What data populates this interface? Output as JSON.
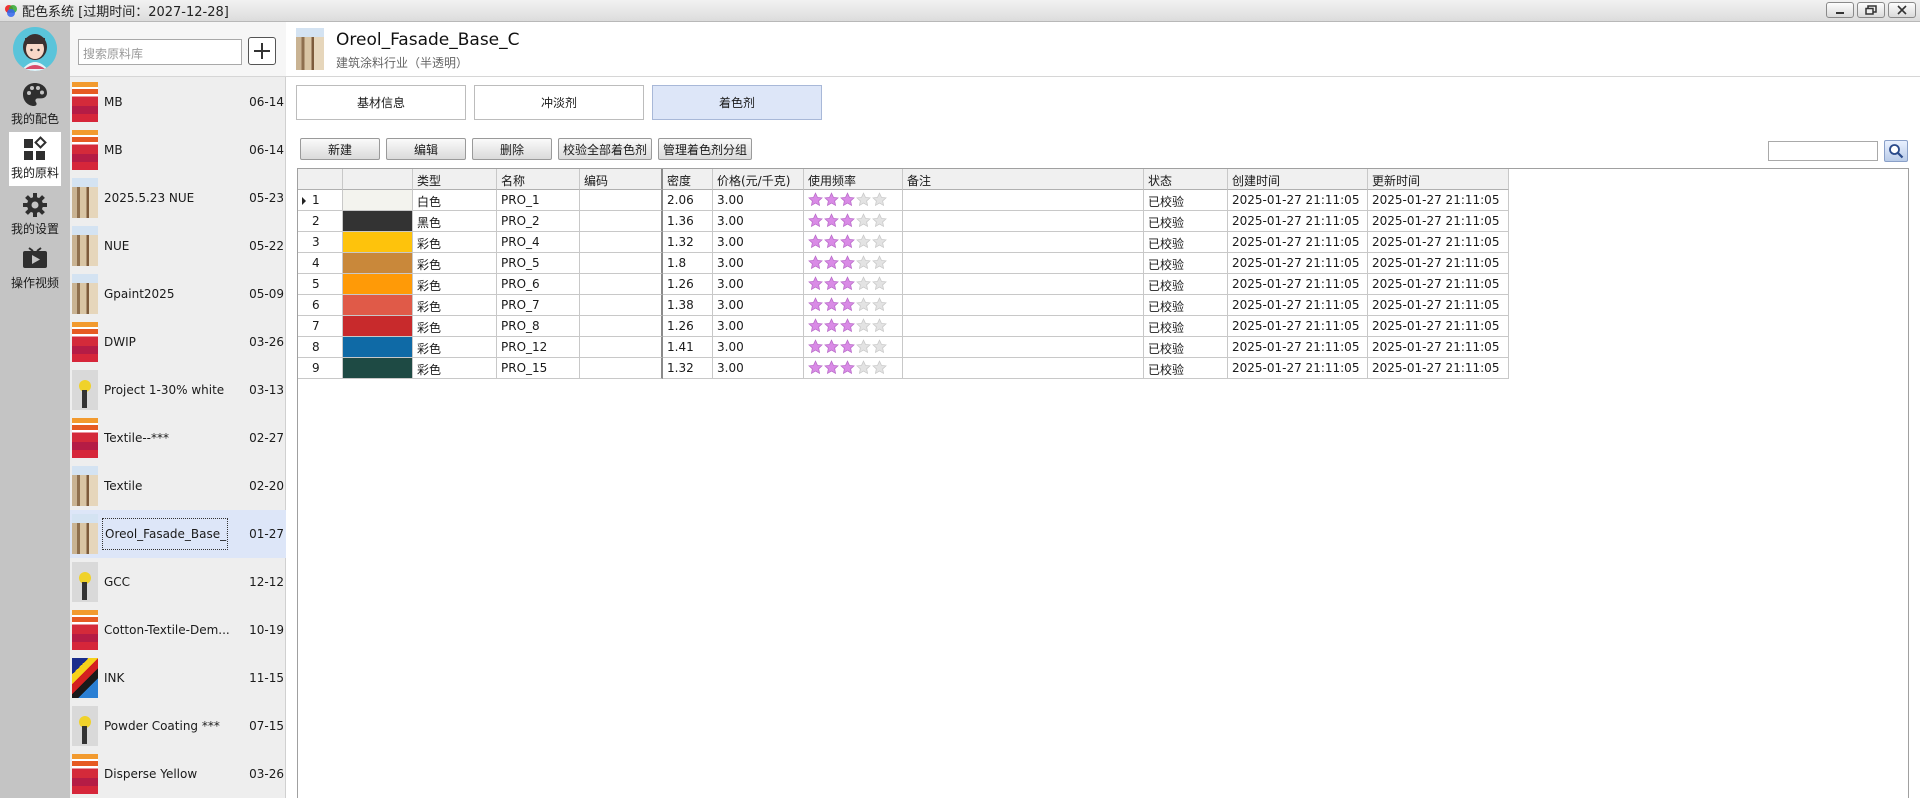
{
  "window": {
    "title": "配色系统  [过期时间：2027-12-28]",
    "buttons": [
      "minimize",
      "restore",
      "close"
    ]
  },
  "nav": {
    "items": [
      {
        "label": "我的配色",
        "icon": "palette-icon",
        "active": false
      },
      {
        "label": "我的原料",
        "icon": "grid-icon",
        "active": true
      },
      {
        "label": "我的设置",
        "icon": "gear-icon",
        "active": false
      },
      {
        "label": "操作视频",
        "icon": "video-icon",
        "active": false
      }
    ]
  },
  "library": {
    "search_placeholder": "搜索原料库",
    "add_label": "+",
    "items": [
      {
        "name": "MB",
        "date": "06-14",
        "thumb": "stripes"
      },
      {
        "name": "MB",
        "date": "06-14",
        "thumb": "stripes"
      },
      {
        "name": "2025.5.23 NUE",
        "date": "05-23",
        "thumb": "building"
      },
      {
        "name": "NUE",
        "date": "05-22",
        "thumb": "building"
      },
      {
        "name": "Gpaint2025",
        "date": "05-09",
        "thumb": "building"
      },
      {
        "name": "DWIP",
        "date": "03-26",
        "thumb": "stripes"
      },
      {
        "name": "Project 1-30% white",
        "date": "03-13",
        "thumb": "rollers"
      },
      {
        "name": "Textile--***",
        "date": "02-27",
        "thumb": "stripes"
      },
      {
        "name": "Textile",
        "date": "02-20",
        "thumb": "building"
      },
      {
        "name": "Oreol_Fasade_Base_C",
        "date": "01-27",
        "thumb": "building",
        "selected": true
      },
      {
        "name": "GCC",
        "date": "12-12",
        "thumb": "rollers"
      },
      {
        "name": "Cotton-Textile-Dem...",
        "date": "10-19",
        "thumb": "stripes"
      },
      {
        "name": "INK",
        "date": "11-15",
        "thumb": "ink"
      },
      {
        "name": "Powder Coating ***",
        "date": "07-15",
        "thumb": "rollers"
      },
      {
        "name": "Disperse Yellow",
        "date": "03-26",
        "thumb": "stripes"
      }
    ]
  },
  "header": {
    "title": "Oreol_Fasade_Base_C",
    "subtitle": "建筑涂料行业（半透明）"
  },
  "tabs": [
    {
      "label": "基材信息",
      "active": false
    },
    {
      "label": "冲淡剂",
      "active": false
    },
    {
      "label": "着色剂",
      "active": true
    }
  ],
  "toolbar": {
    "new_label": "新建",
    "edit_label": "编辑",
    "delete_label": "删除",
    "verify_all_label": "校验全部着色剂",
    "manage_groups_label": "管理着色剂分组"
  },
  "table": {
    "columns": [
      "",
      "",
      "类型",
      "名称",
      "编码",
      "密度",
      "价格(元/千克)",
      "使用频率",
      "备注",
      "状态",
      "创建时间",
      "更新时间"
    ],
    "rows": [
      {
        "no": "1",
        "color": "#f3f3ee",
        "type": "白色",
        "name": "PRO_1",
        "code": "",
        "density": "2.06",
        "price": "3.00",
        "stars": 3,
        "note": "",
        "status": "已校验",
        "created": "2025-01-27 21:11:05",
        "updated": "2025-01-27 21:11:05",
        "current": true
      },
      {
        "no": "2",
        "color": "#333333",
        "type": "黑色",
        "name": "PRO_2",
        "code": "",
        "density": "1.36",
        "price": "3.00",
        "stars": 3,
        "note": "",
        "status": "已校验",
        "created": "2025-01-27 21:11:05",
        "updated": "2025-01-27 21:11:05"
      },
      {
        "no": "3",
        "color": "#fec30c",
        "type": "彩色",
        "name": "PRO_4",
        "code": "",
        "density": "1.32",
        "price": "3.00",
        "stars": 3,
        "note": "",
        "status": "已校验",
        "created": "2025-01-27 21:11:05",
        "updated": "2025-01-27 21:11:05"
      },
      {
        "no": "4",
        "color": "#c9883a",
        "type": "彩色",
        "name": "PRO_5",
        "code": "",
        "density": "1.8",
        "price": "3.00",
        "stars": 3,
        "note": "",
        "status": "已校验",
        "created": "2025-01-27 21:11:05",
        "updated": "2025-01-27 21:11:05"
      },
      {
        "no": "5",
        "color": "#ff9a07",
        "type": "彩色",
        "name": "PRO_6",
        "code": "",
        "density": "1.26",
        "price": "3.00",
        "stars": 3,
        "note": "",
        "status": "已校验",
        "created": "2025-01-27 21:11:05",
        "updated": "2025-01-27 21:11:05"
      },
      {
        "no": "6",
        "color": "#e05a48",
        "type": "彩色",
        "name": "PRO_7",
        "code": "",
        "density": "1.38",
        "price": "3.00",
        "stars": 3,
        "note": "",
        "status": "已校验",
        "created": "2025-01-27 21:11:05",
        "updated": "2025-01-27 21:11:05"
      },
      {
        "no": "7",
        "color": "#c82a2c",
        "type": "彩色",
        "name": "PRO_8",
        "code": "",
        "density": "1.26",
        "price": "3.00",
        "stars": 3,
        "note": "",
        "status": "已校验",
        "created": "2025-01-27 21:11:05",
        "updated": "2025-01-27 21:11:05"
      },
      {
        "no": "8",
        "color": "#0f6aa6",
        "type": "彩色",
        "name": "PRO_12",
        "code": "",
        "density": "1.41",
        "price": "3.00",
        "stars": 3,
        "note": "",
        "status": "已校验",
        "created": "2025-01-27 21:11:05",
        "updated": "2025-01-27 21:11:05"
      },
      {
        "no": "9",
        "color": "#1e4a44",
        "type": "彩色",
        "name": "PRO_15",
        "code": "",
        "density": "1.32",
        "price": "3.00",
        "stars": 3,
        "note": "",
        "status": "已校验",
        "created": "2025-01-27 21:11:05",
        "updated": "2025-01-27 21:11:05"
      }
    ]
  },
  "colors": {
    "accent": "#dde6f8",
    "star_on": "#d98be6",
    "star_off": "#e3e3e3"
  }
}
